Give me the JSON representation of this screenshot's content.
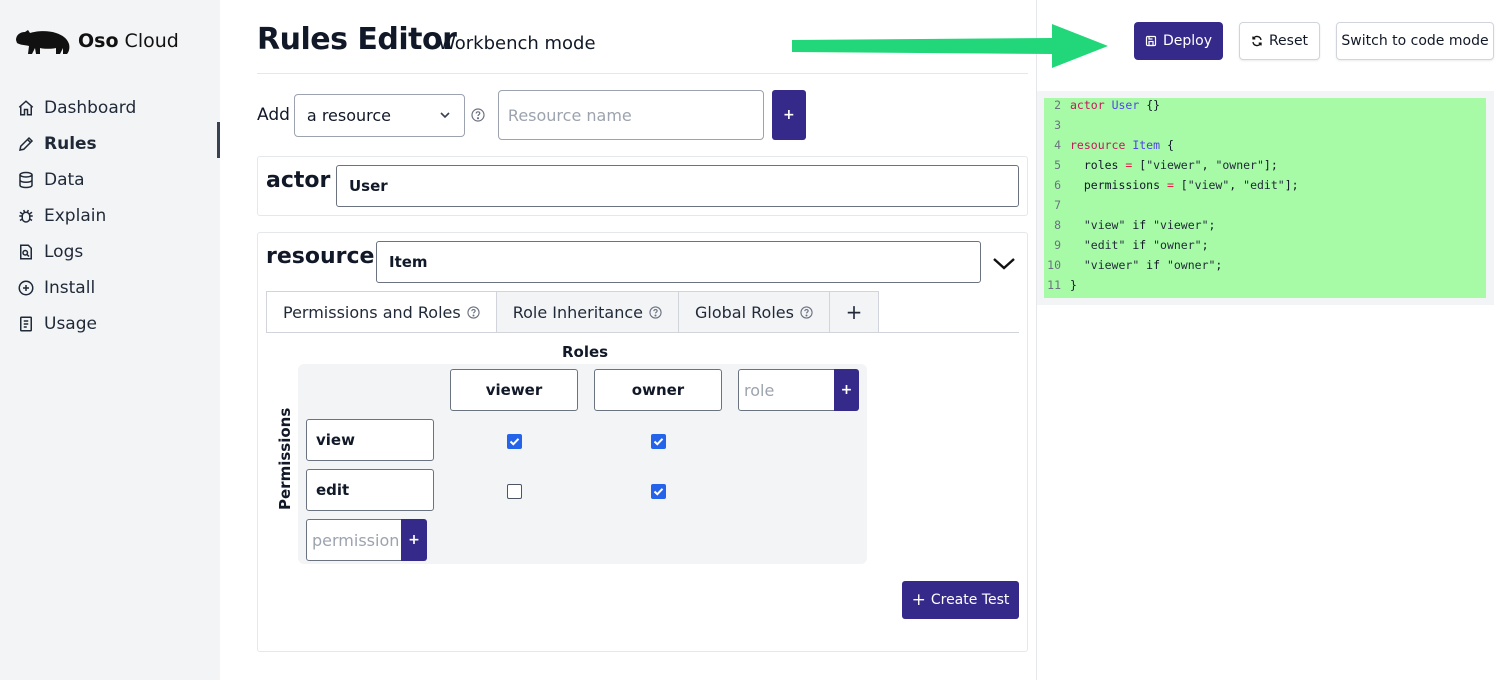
{
  "brand": {
    "name_bold": "Oso",
    "name_rest": " Cloud"
  },
  "sidebar": {
    "items": [
      {
        "label": "Dashboard",
        "icon": "home-icon"
      },
      {
        "label": "Rules",
        "icon": "pencil-icon",
        "active": true
      },
      {
        "label": "Data",
        "icon": "database-icon"
      },
      {
        "label": "Explain",
        "icon": "bug-icon"
      },
      {
        "label": "Logs",
        "icon": "logs-icon"
      },
      {
        "label": "Install",
        "icon": "plus-circle-icon"
      },
      {
        "label": "Usage",
        "icon": "receipt-icon"
      }
    ]
  },
  "header": {
    "title": "Rules Editor",
    "subtitle": "Workbench mode",
    "deploy": "Deploy",
    "reset": "Reset",
    "switch_mode": "Switch to code mode"
  },
  "add_row": {
    "label": "Add",
    "select_value": "a resource",
    "name_placeholder": "Resource name",
    "plus": "+"
  },
  "actor_block": {
    "keyword": "actor",
    "name": "User"
  },
  "resource_block": {
    "keyword": "resource",
    "name": "Item"
  },
  "tabs": [
    {
      "label": "Permissions and Roles",
      "active": true
    },
    {
      "label": "Role Inheritance"
    },
    {
      "label": "Global Roles"
    }
  ],
  "tab_add": "+",
  "matrix": {
    "roles_header": "Roles",
    "permissions_header": "Permissions",
    "roles": [
      "viewer",
      "owner"
    ],
    "role_placeholder": "role",
    "permissions": [
      "view",
      "edit"
    ],
    "permission_placeholder": "permission",
    "grants": [
      [
        true,
        true
      ],
      [
        false,
        true
      ]
    ],
    "plus": "+"
  },
  "create_test": {
    "plus": "+",
    "label": "Create Test"
  },
  "code": {
    "lines": [
      {
        "n": "2",
        "text": "actor User {}"
      },
      {
        "n": "3",
        "text": ""
      },
      {
        "n": "4",
        "text": "resource Item {"
      },
      {
        "n": "5",
        "text": "  roles = [\"viewer\", \"owner\"];"
      },
      {
        "n": "6",
        "text": "  permissions = [\"view\", \"edit\"];"
      },
      {
        "n": "7",
        "text": ""
      },
      {
        "n": "8",
        "text": "  \"view\" if \"viewer\";"
      },
      {
        "n": "9",
        "text": "  \"edit\" if \"owner\";"
      },
      {
        "n": "10",
        "text": "  \"viewer\" if \"owner\";"
      },
      {
        "n": "11",
        "text": "}"
      }
    ]
  },
  "colors": {
    "accent": "#352a8a",
    "arrow": "#22d67a",
    "code_bg": "#a7fba7",
    "checkbox": "#2563eb"
  }
}
